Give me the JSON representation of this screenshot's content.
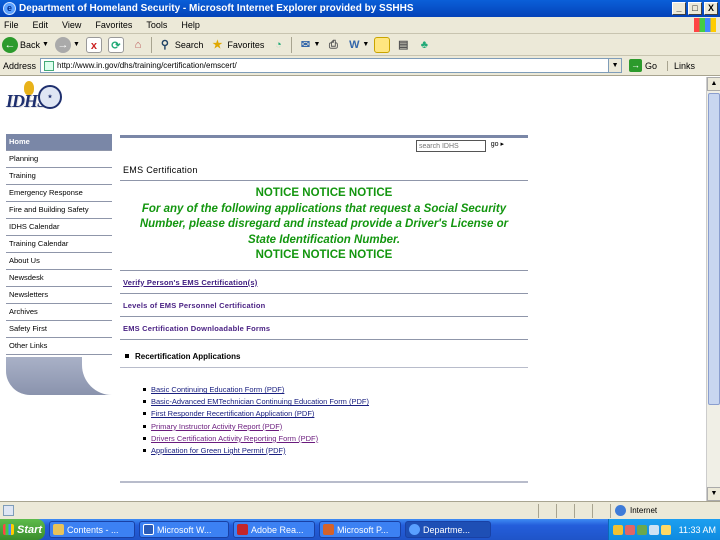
{
  "window": {
    "title": "Department of Homeland Security - Microsoft Internet Explorer provided by SSHHS",
    "minimize": "_",
    "maximize": "□",
    "close": "X"
  },
  "menubar": {
    "items": [
      "File",
      "Edit",
      "View",
      "Favorites",
      "Tools",
      "Help"
    ]
  },
  "toolbar": {
    "back_label": "Back",
    "search_label": "Search",
    "favorites_label": "Favorites"
  },
  "addressbar": {
    "label": "Address",
    "url": "http://www.in.gov/dhs/training/certification/emscert/",
    "go_label": "Go",
    "links_label": "Links"
  },
  "site": {
    "logo_text": "IDHS"
  },
  "sidebar": {
    "items": [
      "Home",
      "Planning",
      "Training",
      "Emergency Response",
      "Fire and Building Safety",
      "IDHS Calendar",
      "Training Calendar",
      "About Us",
      "Newsdesk",
      "Newsletters",
      "Archives",
      "Safety First",
      "Other Links"
    ]
  },
  "search": {
    "placeholder": "search IDHS",
    "go_label": "go ▸"
  },
  "main": {
    "section_title": "EMS Certification",
    "notice": {
      "line1": "NOTICE NOTICE NOTICE",
      "body": "For any of the following applications that request a Social Security Number, please disregard and instead provide a Driver's License or State Identification Number.",
      "line_end": "NOTICE NOTICE NOTICE"
    },
    "links": [
      "Verify Person's EMS Certification(s)",
      "Levels of EMS Personnel Certification",
      "EMS Certification Downloadable Forms"
    ],
    "recert_heading": "Recertification Applications",
    "forms": [
      "Basic Continuing Education Form (PDF)",
      "Basic-Advanced EMTechnician Continuing Education Form (PDF)",
      "First Responder Recertification Application (PDF)",
      "Primary Instructor Activity Report (PDF)",
      "Drivers Certification Activity Reporting Form (PDF)",
      "Application for Green Light Permit (PDF)"
    ]
  },
  "statusbar": {
    "zone": "Internet"
  },
  "taskbar": {
    "start_label": "Start",
    "tasks": [
      "Contents - ...",
      "Microsoft W...",
      "Adobe Rea...",
      "Microsoft P...",
      "Departme..."
    ],
    "clock": "11:33 AM"
  },
  "colors": {
    "notice_green": "#13960f",
    "nav_active": "#7a87a7",
    "link_purple": "#4b2384",
    "titlebar_blue": "#0a5fd8"
  }
}
